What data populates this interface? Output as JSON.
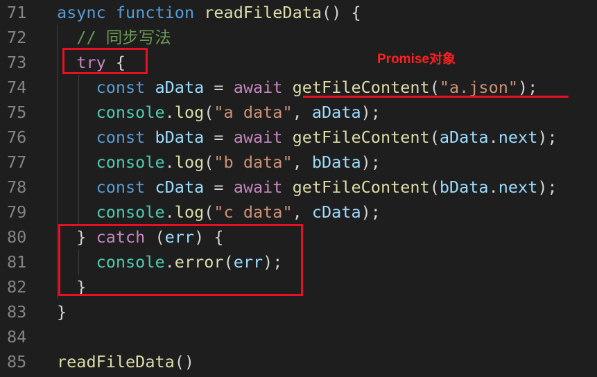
{
  "editor": {
    "lines": [
      {
        "num": "71",
        "tokens": [
          {
            "t": "async",
            "c": "kw"
          },
          {
            "t": " ",
            "c": "pun"
          },
          {
            "t": "function",
            "c": "kw"
          },
          {
            "t": " ",
            "c": "pun"
          },
          {
            "t": "readFileData",
            "c": "fn"
          },
          {
            "t": "() {",
            "c": "pun"
          }
        ]
      },
      {
        "num": "72",
        "tokens": [
          {
            "t": "  ",
            "c": "pun"
          },
          {
            "t": "// 同步写法",
            "c": "cmt"
          }
        ]
      },
      {
        "num": "73",
        "tokens": [
          {
            "t": "  ",
            "c": "pun"
          },
          {
            "t": "try",
            "c": "ctl"
          },
          {
            "t": " {",
            "c": "pun"
          }
        ]
      },
      {
        "num": "74",
        "tokens": [
          {
            "t": "    ",
            "c": "pun"
          },
          {
            "t": "const",
            "c": "kw"
          },
          {
            "t": " ",
            "c": "pun"
          },
          {
            "t": "aData",
            "c": "var"
          },
          {
            "t": " = ",
            "c": "pun"
          },
          {
            "t": "await",
            "c": "ctl"
          },
          {
            "t": " ",
            "c": "pun"
          },
          {
            "t": "getFileContent",
            "c": "fn"
          },
          {
            "t": "(",
            "c": "pun"
          },
          {
            "t": "\"a.json\"",
            "c": "str"
          },
          {
            "t": ");",
            "c": "pun"
          }
        ]
      },
      {
        "num": "75",
        "tokens": [
          {
            "t": "    ",
            "c": "pun"
          },
          {
            "t": "console",
            "c": "cls"
          },
          {
            "t": ".",
            "c": "pun"
          },
          {
            "t": "log",
            "c": "fn"
          },
          {
            "t": "(",
            "c": "pun"
          },
          {
            "t": "\"a data\"",
            "c": "str"
          },
          {
            "t": ", ",
            "c": "pun"
          },
          {
            "t": "aData",
            "c": "var"
          },
          {
            "t": ");",
            "c": "pun"
          }
        ]
      },
      {
        "num": "76",
        "tokens": [
          {
            "t": "    ",
            "c": "pun"
          },
          {
            "t": "const",
            "c": "kw"
          },
          {
            "t": " ",
            "c": "pun"
          },
          {
            "t": "bData",
            "c": "var"
          },
          {
            "t": " = ",
            "c": "pun"
          },
          {
            "t": "await",
            "c": "ctl"
          },
          {
            "t": " ",
            "c": "pun"
          },
          {
            "t": "getFileContent",
            "c": "fn"
          },
          {
            "t": "(",
            "c": "pun"
          },
          {
            "t": "aData",
            "c": "var"
          },
          {
            "t": ".",
            "c": "pun"
          },
          {
            "t": "next",
            "c": "var"
          },
          {
            "t": ");",
            "c": "pun"
          }
        ]
      },
      {
        "num": "77",
        "tokens": [
          {
            "t": "    ",
            "c": "pun"
          },
          {
            "t": "console",
            "c": "cls"
          },
          {
            "t": ".",
            "c": "pun"
          },
          {
            "t": "log",
            "c": "fn"
          },
          {
            "t": "(",
            "c": "pun"
          },
          {
            "t": "\"b data\"",
            "c": "str"
          },
          {
            "t": ", ",
            "c": "pun"
          },
          {
            "t": "bData",
            "c": "var"
          },
          {
            "t": ");",
            "c": "pun"
          }
        ]
      },
      {
        "num": "78",
        "tokens": [
          {
            "t": "    ",
            "c": "pun"
          },
          {
            "t": "const",
            "c": "kw"
          },
          {
            "t": " ",
            "c": "pun"
          },
          {
            "t": "cData",
            "c": "var"
          },
          {
            "t": " = ",
            "c": "pun"
          },
          {
            "t": "await",
            "c": "ctl"
          },
          {
            "t": " ",
            "c": "pun"
          },
          {
            "t": "getFileContent",
            "c": "fn"
          },
          {
            "t": "(",
            "c": "pun"
          },
          {
            "t": "bData",
            "c": "var"
          },
          {
            "t": ".",
            "c": "pun"
          },
          {
            "t": "next",
            "c": "var"
          },
          {
            "t": ");",
            "c": "pun"
          }
        ]
      },
      {
        "num": "79",
        "tokens": [
          {
            "t": "    ",
            "c": "pun"
          },
          {
            "t": "console",
            "c": "cls"
          },
          {
            "t": ".",
            "c": "pun"
          },
          {
            "t": "log",
            "c": "fn"
          },
          {
            "t": "(",
            "c": "pun"
          },
          {
            "t": "\"c data\"",
            "c": "str"
          },
          {
            "t": ", ",
            "c": "pun"
          },
          {
            "t": "cData",
            "c": "var"
          },
          {
            "t": ");",
            "c": "pun"
          }
        ]
      },
      {
        "num": "80",
        "tokens": [
          {
            "t": "  } ",
            "c": "pun"
          },
          {
            "t": "catch",
            "c": "ctl"
          },
          {
            "t": " (",
            "c": "pun"
          },
          {
            "t": "err",
            "c": "var"
          },
          {
            "t": ") {",
            "c": "pun"
          }
        ]
      },
      {
        "num": "81",
        "tokens": [
          {
            "t": "    ",
            "c": "pun"
          },
          {
            "t": "console",
            "c": "cls"
          },
          {
            "t": ".",
            "c": "pun"
          },
          {
            "t": "error",
            "c": "fn"
          },
          {
            "t": "(",
            "c": "pun"
          },
          {
            "t": "err",
            "c": "var"
          },
          {
            "t": ");",
            "c": "pun"
          }
        ]
      },
      {
        "num": "82",
        "tokens": [
          {
            "t": "  }",
            "c": "pun"
          }
        ]
      },
      {
        "num": "83",
        "tokens": [
          {
            "t": "}",
            "c": "pun"
          }
        ]
      },
      {
        "num": "84",
        "tokens": []
      },
      {
        "num": "85",
        "tokens": [
          {
            "t": "readFileData",
            "c": "fn"
          },
          {
            "t": "()",
            "c": "pun"
          }
        ]
      }
    ]
  },
  "annotations": {
    "label": "Promise对象",
    "color": "#e81123"
  },
  "theme": {
    "background": "#1e1e1e",
    "line_number": "#858585",
    "keyword": "#569cd6",
    "control": "#c586c0",
    "function": "#dcdcaa",
    "variable": "#9cdcfe",
    "string": "#ce9178",
    "class": "#4ec9b0",
    "comment": "#6a9955"
  }
}
